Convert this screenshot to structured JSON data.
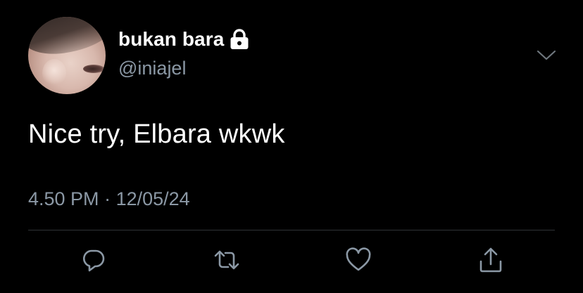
{
  "tweet": {
    "display_name": "bukan bara",
    "handle": "@iniajel",
    "text": "Nice try, Elbara wkwk",
    "time": "4.50 PM",
    "separator": "·",
    "date": "12/05/24",
    "account_locked": true
  },
  "icons": {
    "lock": "lock-icon",
    "more": "chevron-down-icon",
    "reply": "reply-icon",
    "retweet": "retweet-icon",
    "like": "heart-icon",
    "share": "share-icon"
  },
  "colors": {
    "background": "#000000",
    "primary_text": "#ffffff",
    "secondary_text": "#8b98a5",
    "divider": "#2f3336"
  }
}
